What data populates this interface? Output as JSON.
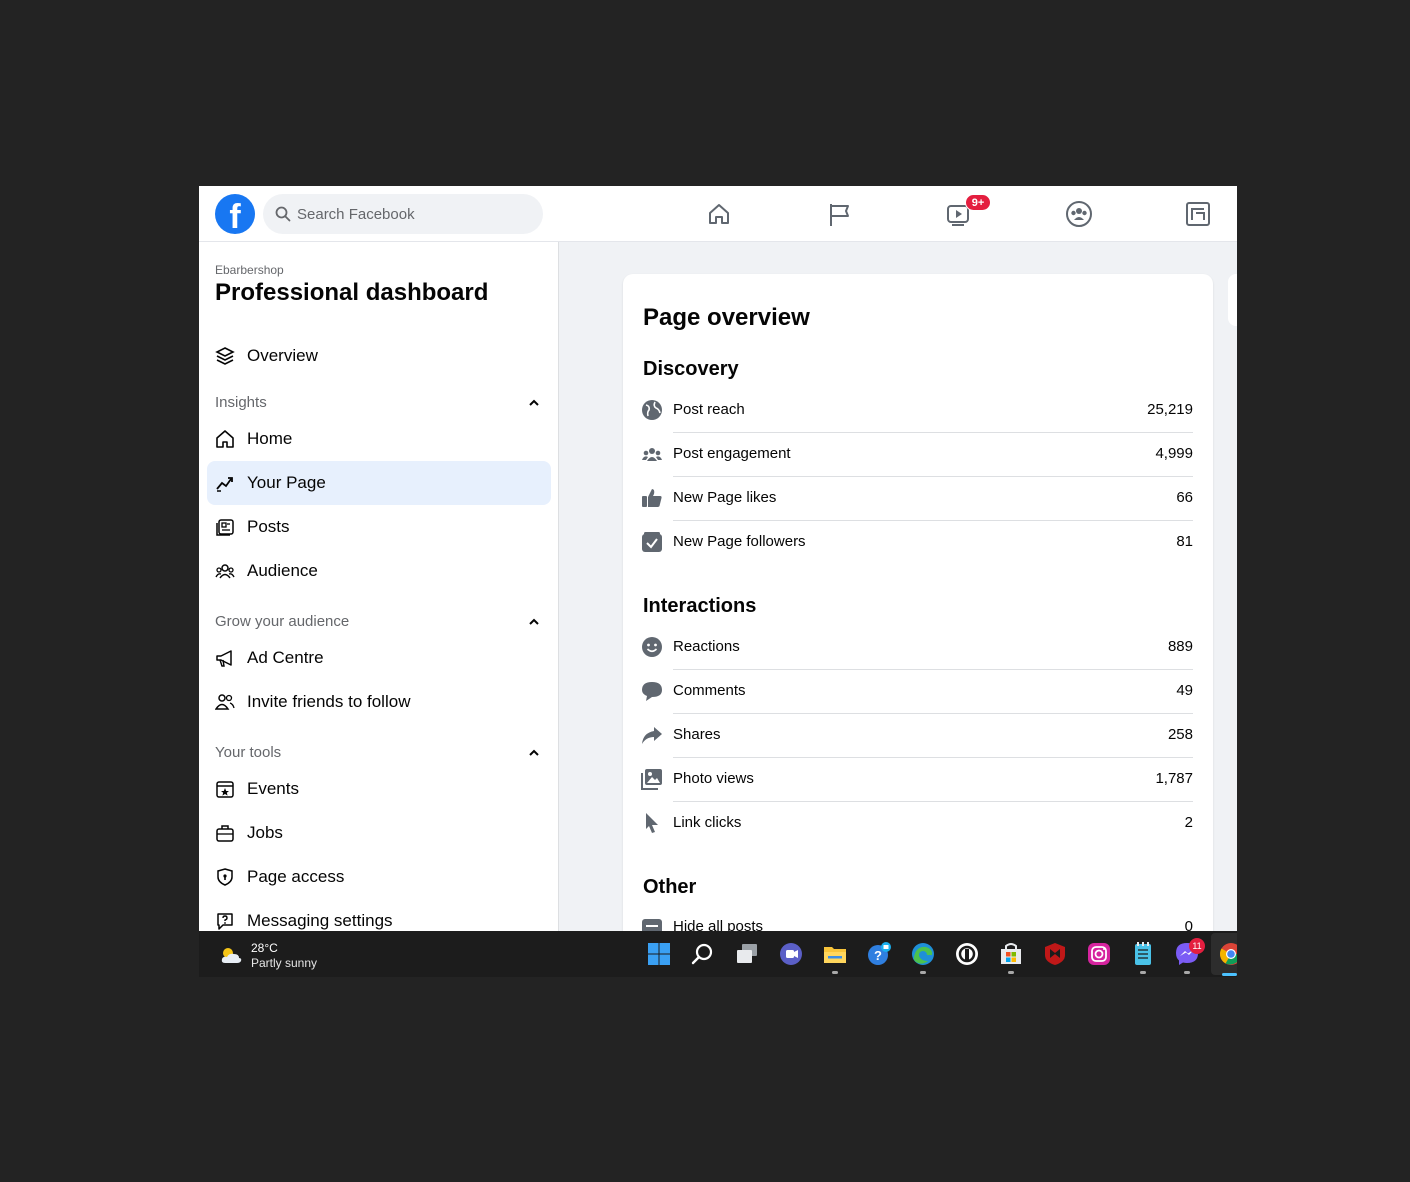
{
  "search": {
    "placeholder": "Search Facebook"
  },
  "nav": {
    "icons": [
      "home-icon",
      "flag-icon",
      "video-icon",
      "groups-icon",
      "gaming-icon"
    ],
    "video_badge": "9+"
  },
  "sidebar": {
    "page_name": "Ebarbershop",
    "title": "Professional dashboard",
    "overview_label": "Overview",
    "sections": [
      {
        "label": "Insights",
        "items": [
          "Home",
          "Your Page",
          "Posts",
          "Audience"
        ]
      },
      {
        "label": "Grow your audience",
        "items": [
          "Ad Centre",
          "Invite friends to follow"
        ]
      },
      {
        "label": "Your tools",
        "items": [
          "Events",
          "Jobs",
          "Page access",
          "Messaging settings"
        ]
      }
    ],
    "active_item": "Your Page"
  },
  "overview": {
    "title": "Page overview",
    "discovery": {
      "title": "Discovery",
      "rows": [
        {
          "label": "Post reach",
          "value": "25,219",
          "icon": "globe-icon"
        },
        {
          "label": "Post engagement",
          "value": "4,999",
          "icon": "people-icon"
        },
        {
          "label": "New Page likes",
          "value": "66",
          "icon": "thumbs-up-icon"
        },
        {
          "label": "New Page followers",
          "value": "81",
          "icon": "follow-check-icon"
        }
      ]
    },
    "interactions": {
      "title": "Interactions",
      "rows": [
        {
          "label": "Reactions",
          "value": "889",
          "icon": "smiley-icon"
        },
        {
          "label": "Comments",
          "value": "49",
          "icon": "comment-icon"
        },
        {
          "label": "Shares",
          "value": "258",
          "icon": "share-arrow-icon"
        },
        {
          "label": "Photo views",
          "value": "1,787",
          "icon": "photo-icon"
        },
        {
          "label": "Link clicks",
          "value": "2",
          "icon": "cursor-icon"
        }
      ]
    },
    "other": {
      "title": "Other",
      "rows": [
        {
          "label": "Hide all posts",
          "value": "0",
          "icon": "hide-icon"
        }
      ]
    }
  },
  "taskbar": {
    "temp": "28°C",
    "condition": "Partly sunny",
    "messenger_badge": "11",
    "apps": [
      "windows-start-icon",
      "search-icon",
      "task-view-icon",
      "teams-icon",
      "file-explorer-icon",
      "help-icon",
      "edge-icon",
      "app-icon",
      "store-icon",
      "mcafee-icon",
      "instagram-icon",
      "notepad-icon",
      "messenger-icon",
      "chrome-icon"
    ]
  },
  "colors": {
    "brand": "#1877f2",
    "active_bg": "#e7f0fd",
    "badge": "#e41e3f"
  }
}
